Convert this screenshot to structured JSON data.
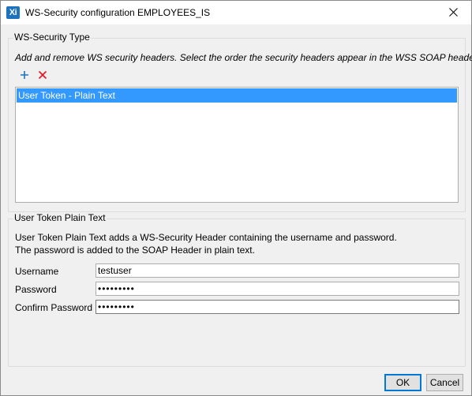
{
  "window": {
    "app_icon_text": "Xi",
    "title": "WS-Security configuration EMPLOYEES_IS"
  },
  "ws_security_type": {
    "legend": "WS-Security Type",
    "description": "Add and remove WS security headers. Select the order the security headers appear in the WSS SOAP header",
    "toolbar": {
      "add_icon": "plus-icon",
      "remove_icon": "x-icon"
    },
    "headers": [
      {
        "label": "User Token - Plain Text",
        "selected": true
      }
    ]
  },
  "user_token": {
    "legend": "User Token Plain Text",
    "description_line1": "User Token Plain Text adds a WS-Security Header containing the username and password.",
    "description_line2": "The password is added to the SOAP Header in plain text.",
    "username_label": "Username",
    "username_value": "testuser",
    "password_label": "Password",
    "password_value": "•••••••••",
    "confirm_label": "Confirm Password",
    "confirm_value": "•••••••••"
  },
  "buttons": {
    "ok": "OK",
    "cancel": "Cancel"
  },
  "colors": {
    "selection": "#3399ff",
    "add_icon": "#1e73be",
    "remove_icon": "#e81123"
  }
}
